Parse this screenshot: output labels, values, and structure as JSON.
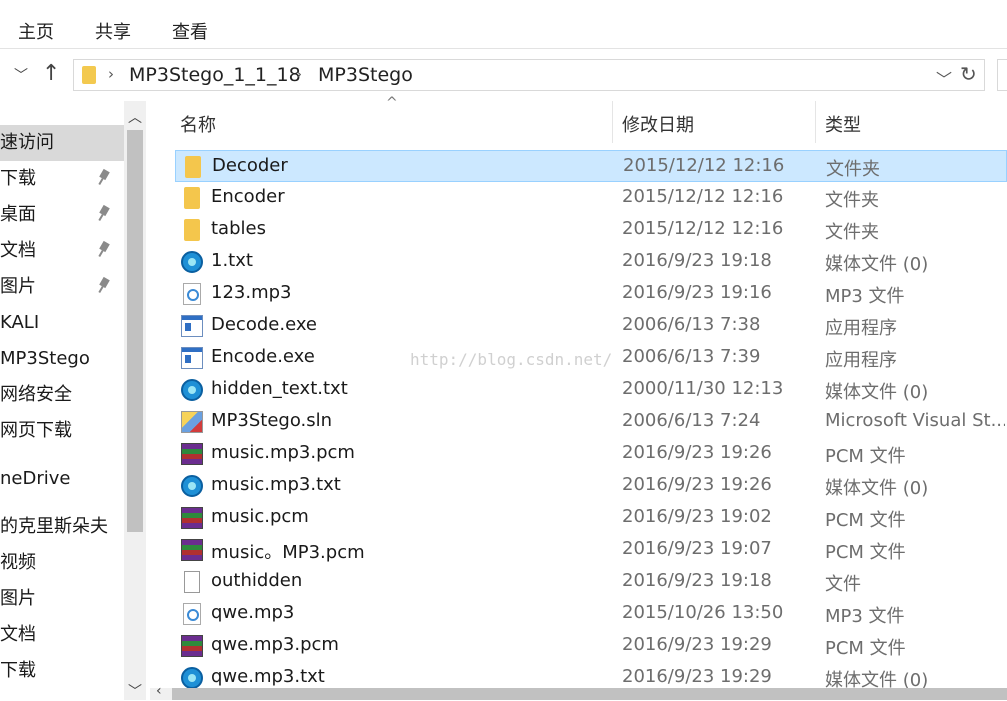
{
  "ribbon": {
    "tabs": [
      "主页",
      "共享",
      "查看"
    ]
  },
  "address": {
    "breadcrumbs": [
      "MP3Stego_1_1_18",
      "MP3Stego"
    ]
  },
  "sidebar": {
    "items": [
      {
        "label": "速访问",
        "pinned": false,
        "active": true
      },
      {
        "label": "下载",
        "pinned": true
      },
      {
        "label": "桌面",
        "pinned": true
      },
      {
        "label": "文档",
        "pinned": true
      },
      {
        "label": "图片",
        "pinned": true
      },
      {
        "label": "KALI",
        "pinned": false
      },
      {
        "label": "MP3Stego",
        "pinned": false
      },
      {
        "label": "网络安全",
        "pinned": false
      },
      {
        "label": "网页下载",
        "pinned": false
      },
      {
        "label": "neDrive",
        "pinned": false
      },
      {
        "label": "的克里斯朵夫",
        "pinned": false
      },
      {
        "label": "视频",
        "pinned": false
      },
      {
        "label": "图片",
        "pinned": false
      },
      {
        "label": "文档",
        "pinned": false
      },
      {
        "label": "下载",
        "pinned": false
      }
    ]
  },
  "columns": {
    "name": "名称",
    "date": "修改日期",
    "type": "类型"
  },
  "files": [
    {
      "name": "Decoder",
      "date": "2015/12/12 12:16",
      "type": "文件夹",
      "icon": "folder-icon",
      "selected": true
    },
    {
      "name": "Encoder",
      "date": "2015/12/12 12:16",
      "type": "文件夹",
      "icon": "folder-icon"
    },
    {
      "name": "tables",
      "date": "2015/12/12 12:16",
      "type": "文件夹",
      "icon": "folder-icon"
    },
    {
      "name": "1.txt",
      "date": "2016/9/23 19:18",
      "type": "媒体文件 (0)",
      "icon": "media-file-icon"
    },
    {
      "name": "123.mp3",
      "date": "2016/9/23 19:16",
      "type": "MP3 文件",
      "icon": "mp3-file-icon"
    },
    {
      "name": "Decode.exe",
      "date": "2006/6/13 7:38",
      "type": "应用程序",
      "icon": "exe-icon"
    },
    {
      "name": "Encode.exe",
      "date": "2006/6/13 7:39",
      "type": "应用程序",
      "icon": "exe-icon"
    },
    {
      "name": "hidden_text.txt",
      "date": "2000/11/30 12:13",
      "type": "媒体文件 (0)",
      "icon": "media-file-icon"
    },
    {
      "name": "MP3Stego.sln",
      "date": "2006/6/13 7:24",
      "type": "Microsoft Visual St...",
      "icon": "sln-icon"
    },
    {
      "name": "music.mp3.pcm",
      "date": "2016/9/23 19:26",
      "type": "PCM 文件",
      "icon": "archive-icon"
    },
    {
      "name": "music.mp3.txt",
      "date": "2016/9/23 19:26",
      "type": "媒体文件 (0)",
      "icon": "media-file-icon"
    },
    {
      "name": "music.pcm",
      "date": "2016/9/23 19:02",
      "type": "PCM 文件",
      "icon": "archive-icon"
    },
    {
      "name": "music。MP3.pcm",
      "date": "2016/9/23 19:07",
      "type": "PCM 文件",
      "icon": "archive-icon"
    },
    {
      "name": "outhidden",
      "date": "2016/9/23 19:18",
      "type": "文件",
      "icon": "blank-file-icon"
    },
    {
      "name": "qwe.mp3",
      "date": "2015/10/26 13:50",
      "type": "MP3 文件",
      "icon": "mp3-file-icon"
    },
    {
      "name": "qwe.mp3.pcm",
      "date": "2016/9/23 19:29",
      "type": "PCM 文件",
      "icon": "archive-icon"
    },
    {
      "name": "qwe.mp3.txt",
      "date": "2016/9/23 19:29",
      "type": "媒体文件 (0)",
      "icon": "media-file-icon"
    }
  ],
  "watermark": "http://blog.csdn.net/"
}
